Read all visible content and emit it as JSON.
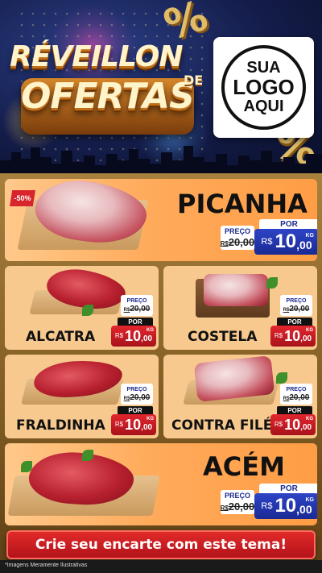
{
  "header": {
    "title_line1": "RÉVEILLON",
    "title_line2": "OFERTAS",
    "title_de": "DE",
    "percent_symbol": "%",
    "logo": {
      "line1": "SUA",
      "line2": "LOGO",
      "line3": "AQUI"
    }
  },
  "products": [
    {
      "name": "PICANHA",
      "badge": "-50%",
      "price_label": "PREÇO",
      "old_price": {
        "prefix": "R$",
        "value": "20,00"
      },
      "por_label": "POR",
      "new_price": {
        "currency": "R$",
        "integer": "10",
        "cents": ",00",
        "unit": "KG"
      }
    },
    {
      "name": "ALCATRA",
      "price_label": "PREÇO",
      "old_price": {
        "prefix": "R$",
        "value": "20,00"
      },
      "por_label": "POR",
      "new_price": {
        "currency": "R$",
        "integer": "10",
        "cents": ",00",
        "unit": "KG"
      }
    },
    {
      "name": "COSTELA",
      "price_label": "PREÇO",
      "old_price": {
        "prefix": "R$",
        "value": "20,00"
      },
      "por_label": "POR",
      "new_price": {
        "currency": "R$",
        "integer": "10",
        "cents": ",00",
        "unit": "KG"
      }
    },
    {
      "name": "FRALDINHA",
      "price_label": "PREÇO",
      "old_price": {
        "prefix": "R$",
        "value": "20,00"
      },
      "por_label": "POR",
      "new_price": {
        "currency": "R$",
        "integer": "10",
        "cents": ",00",
        "unit": "KG"
      }
    },
    {
      "name": "CONTRA FILÉ",
      "price_label": "PREÇO",
      "old_price": {
        "prefix": "R$",
        "value": "20,00"
      },
      "por_label": "POR",
      "new_price": {
        "currency": "R$",
        "integer": "10",
        "cents": ",00",
        "unit": "KG"
      }
    },
    {
      "name": "ACÉM",
      "price_label": "PREÇO",
      "old_price": {
        "prefix": "R$",
        "value": "20,00"
      },
      "por_label": "POR",
      "new_price": {
        "currency": "R$",
        "integer": "10",
        "cents": ",00",
        "unit": "KG"
      }
    }
  ],
  "cta": {
    "label": "Crie seu encarte com este tema!"
  },
  "footer": {
    "disclaimer": "*Imagens Meramente Ilustrativas"
  },
  "colors": {
    "header_bg": "#141d4a",
    "gold": "#e9c46a",
    "card_bg": "#f7c98e",
    "big_card_orange": "#ff9d45",
    "price_blue": "#1a2a94",
    "price_red": "#d8242c",
    "cta_red": "#e12a2a"
  }
}
